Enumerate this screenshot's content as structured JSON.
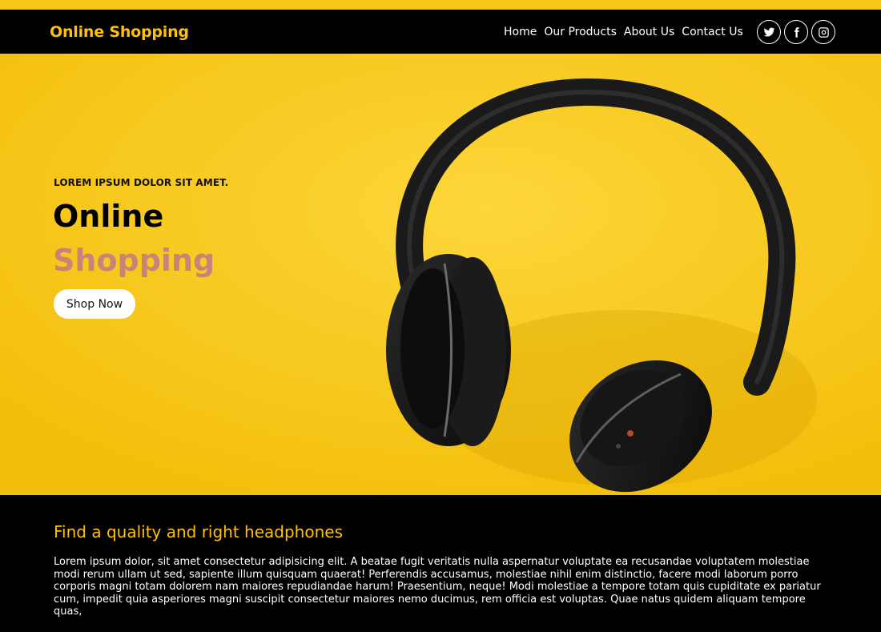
{
  "brand": "Online Shopping",
  "nav": {
    "items": [
      "Home",
      "Our Products",
      "About Us",
      "Contact Us"
    ]
  },
  "social": {
    "icons": [
      "twitter-icon",
      "facebook-icon",
      "instagram-icon"
    ]
  },
  "hero": {
    "kicker": "LOREM IPSUM DOLOR SIT AMET.",
    "title_line1": "Online",
    "title_line2": "Shopping",
    "cta": "Shop Now",
    "bg_color": "#f9c80e",
    "accent_color": "#c9837a"
  },
  "section": {
    "heading": "Find a quality and right headphones",
    "body": "Lorem ipsum dolor, sit amet consectetur adipisicing elit. A beatae fugit veritatis nulla aspernatur voluptate ea recusandae voluptatem molestiae modi rerum ullam ut sed, sapiente illum quisquam quaerat! Perferendis accusamus, molestiae nihil enim distinctio, facere modi laborum porro corporis magni totam dolorem nam maiores repudiandae harum! Praesentium, neque! Modi molestiae a tempore totam quis cupiditate ex pariatur cum, impedit quia asperiores magni suscipit consectetur maiores nemo ducimus, rem officia est voluptas. Quae natus quidem aliquam tempore quas,"
  },
  "colors": {
    "brand": "#ffc107",
    "nav_bg": "#000000",
    "strip": "#f7c81a"
  }
}
